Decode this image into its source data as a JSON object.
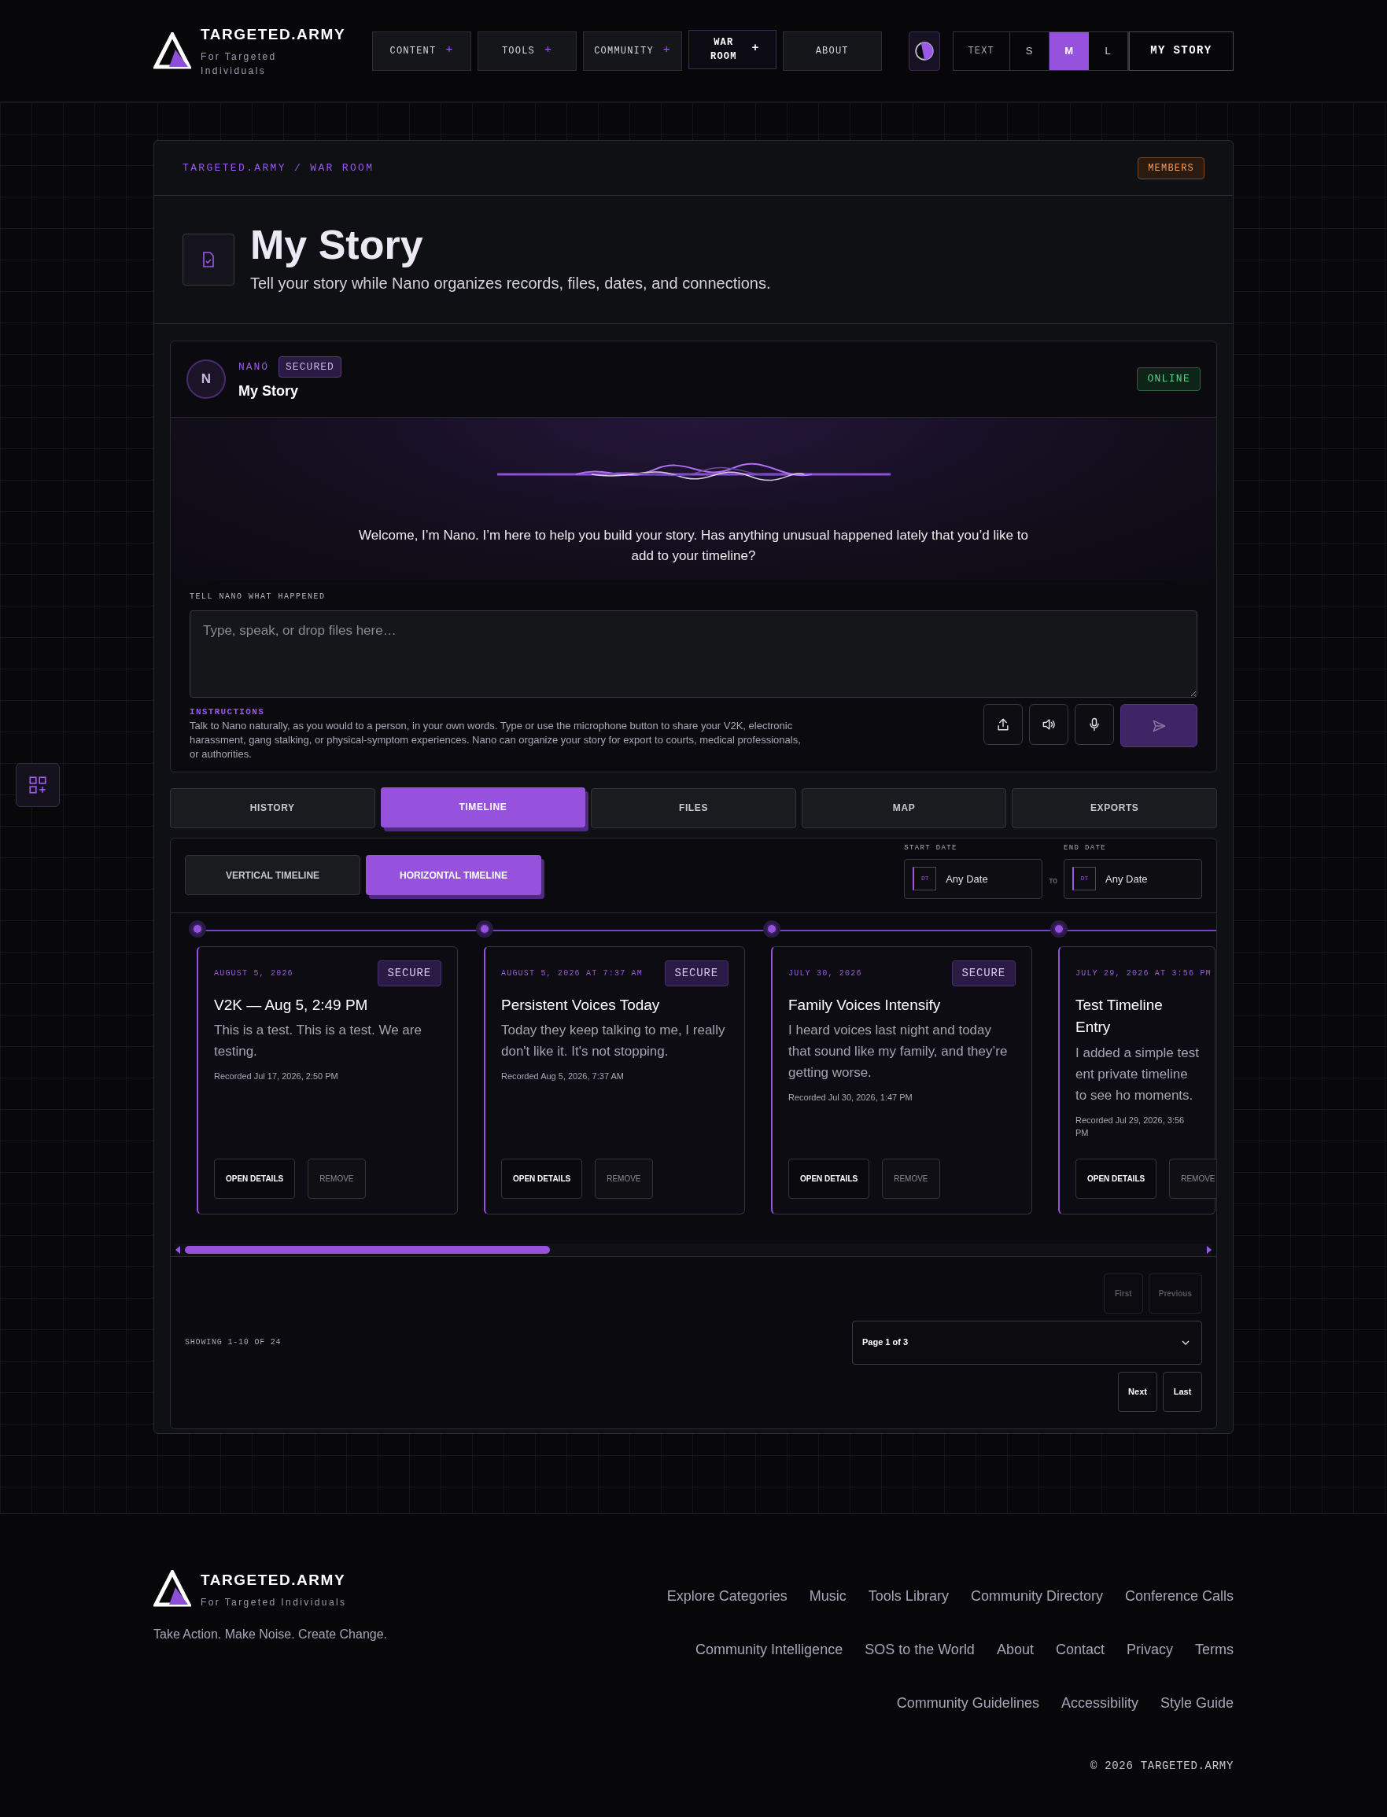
{
  "header": {
    "logo_title": "TARGETED.ARMY",
    "logo_subtitle": "For Targeted Individuals",
    "nav": [
      {
        "label": "CONTENT",
        "expander": "+",
        "selected": false
      },
      {
        "label": "TOOLS",
        "expander": "+",
        "selected": false
      },
      {
        "label": "COMMUNITY",
        "expander": "+",
        "selected": false
      },
      {
        "label": "WAR ROOM",
        "expander": "+",
        "selected": true
      },
      {
        "label": "ABOUT",
        "selected": false
      }
    ],
    "text_size": {
      "label": "TEXT",
      "options": [
        {
          "label": "S",
          "selected": false
        },
        {
          "label": "M",
          "selected": true
        },
        {
          "label": "L",
          "selected": false
        }
      ]
    },
    "story_button": "MY STORY"
  },
  "page": {
    "breadcrumb": "TARGETED.ARMY / WAR ROOM",
    "badge": "MEMBERS",
    "title": "My Story",
    "subtitle": "Tell your story while Nano organizes records, files, dates, and connections."
  },
  "assistant": {
    "avatar": "N",
    "name": "NANO",
    "secured_badge": "SECURED",
    "title": "My Story",
    "status": "ONLINE",
    "welcome": "Welcome, I’m Nano. I’m here to help you build your story. Has anything unusual happened lately that you’d like to add to your timeline?",
    "input_label": "TELL NANO WHAT HAPPENED",
    "placeholder": "Type, speak, or drop files here…",
    "instructions_title": "INSTRUCTIONS",
    "instructions": "Talk to Nano naturally, as you would to a person, in your own words. Type or use the microphone button to share your V2K, electronic harassment, gang stalking, or physical-symptom experiences. Nano can organize your story for export to courts, medical professionals, or authorities."
  },
  "tabs": [
    {
      "label": "HISTORY",
      "selected": false
    },
    {
      "label": "TIMELINE",
      "selected": true
    },
    {
      "label": "FILES",
      "selected": false
    },
    {
      "label": "MAP",
      "selected": false
    },
    {
      "label": "EXPORTS",
      "selected": false
    }
  ],
  "timeline": {
    "views": [
      {
        "label": "VERTICAL TIMELINE",
        "selected": false
      },
      {
        "label": "HORIZONTAL TIMELINE",
        "selected": true
      }
    ],
    "start_date": {
      "label": "START DATE",
      "tag": "DT",
      "value": "Any Date"
    },
    "separator": "TO",
    "end_date": {
      "label": "END DATE",
      "tag": "DT",
      "value": "Any Date"
    },
    "entries": [
      {
        "date": "AUGUST 5, 2026",
        "badge": "SECURE",
        "title": "V2K — Aug 5, 2:49 PM",
        "body": "This is a test. This is a test. We are testing.",
        "recorded": "Recorded Jul 17, 2026, 2:50 PM",
        "actions": [
          "OPEN DETAILS",
          "REMOVE"
        ]
      },
      {
        "date": "AUGUST 5, 2026 AT 7:37 AM",
        "badge": "SECURE",
        "title": "Persistent Voices Today",
        "body": "Today they keep talking to me, I really don't like it. It's not stopping.",
        "recorded": "Recorded Aug 5, 2026, 7:37 AM",
        "actions": [
          "OPEN DETAILS",
          "REMOVE"
        ]
      },
      {
        "date": "JULY 30, 2026",
        "badge": "SECURE",
        "title": "Family Voices Intensify",
        "body": "I heard voices last night and today that sound like my family, and they’re getting worse.",
        "recorded": "Recorded Jul 30, 2026, 1:47 PM",
        "actions": [
          "OPEN DETAILS",
          "REMOVE"
        ]
      },
      {
        "date": "JULY 29, 2026 AT 3:56 PM",
        "title": "Test Timeline Entry",
        "body": "I added a simple test ent private timeline to see ho moments.",
        "recorded": "Recorded Jul 29, 2026, 3:56 PM",
        "actions": [
          "OPEN DETAILS",
          "REMOVE"
        ]
      }
    ]
  },
  "pagination": {
    "summary": "SHOWING 1-10 OF 24",
    "top_buttons": [
      {
        "label": "First",
        "disabled": true
      },
      {
        "label": "Previous",
        "disabled": true
      }
    ],
    "page_select": "Page 1 of 3",
    "bottom_buttons": [
      {
        "label": "Next",
        "disabled": false
      },
      {
        "label": "Last",
        "disabled": false
      }
    ]
  },
  "footer": {
    "logo_title": "TARGETED.ARMY",
    "logo_subtitle": "For Targeted Individuals",
    "tagline": "Take Action. Make Noise. Create Change.",
    "link_rows": [
      [
        "Explore Categories",
        "Music",
        "Tools Library",
        "Community Directory",
        "Conference Calls"
      ],
      [
        "Community Intelligence",
        "SOS to the World",
        "About",
        "Contact",
        "Privacy",
        "Terms"
      ],
      [
        "Community Guidelines",
        "Accessibility",
        "Style Guide"
      ]
    ],
    "copyright": "© 2026 TARGETED.ARMY"
  }
}
